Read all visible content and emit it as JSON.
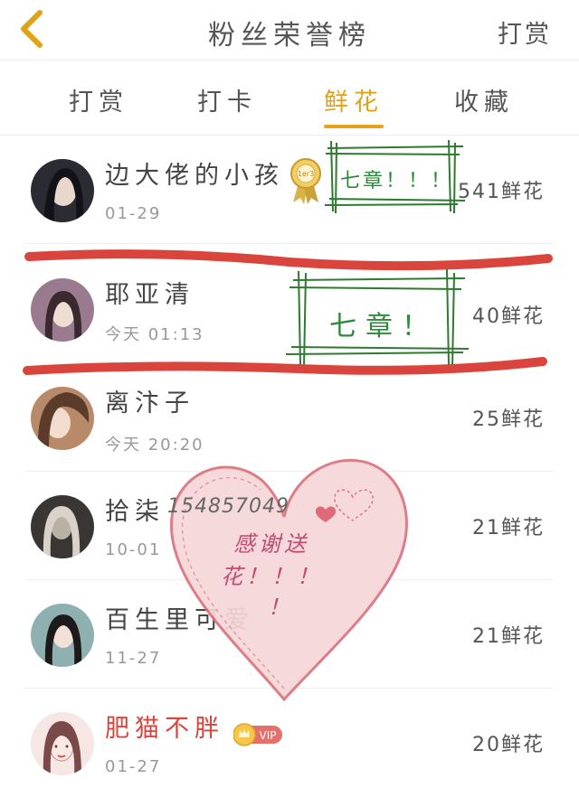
{
  "header": {
    "title": "粉丝荣誉榜",
    "action": "打赏"
  },
  "tabs": [
    {
      "label": "打赏"
    },
    {
      "label": "打卡"
    },
    {
      "label": "鲜花"
    },
    {
      "label": "收藏"
    }
  ],
  "rows": [
    {
      "name": "边大佬的小孩",
      "date": "01-29",
      "count": "541鲜花"
    },
    {
      "name": "耶亚清",
      "date": "今天 01:13",
      "count": "40鲜花"
    },
    {
      "name": "离汴子",
      "date": "今天 20:20",
      "count": "25鲜花"
    },
    {
      "name": "拾柒",
      "date": "10-01",
      "count": "21鲜花"
    },
    {
      "name": "百生里可爱",
      "date": "11-27",
      "count": "21鲜花"
    },
    {
      "name": "肥猫不胖",
      "date": "01-27",
      "count": "20鲜花"
    }
  ],
  "overlays": {
    "stamp1": "七章！！！",
    "stamp2": "七章！",
    "number": "154857049",
    "heart_line1": "感谢送",
    "heart_line2": "花！！！",
    "heart_line3": "！",
    "vip": "VIP",
    "medal_text": "1er3"
  },
  "colors": {
    "accent": "#e8a317",
    "stamp": "#2e8a3a",
    "marker": "#d9453c",
    "heart": "#c24b6e"
  },
  "icons": {
    "back": "chevron-left-icon",
    "medal": "rosette-medal-icon",
    "vip": "crown-vip-icon"
  }
}
